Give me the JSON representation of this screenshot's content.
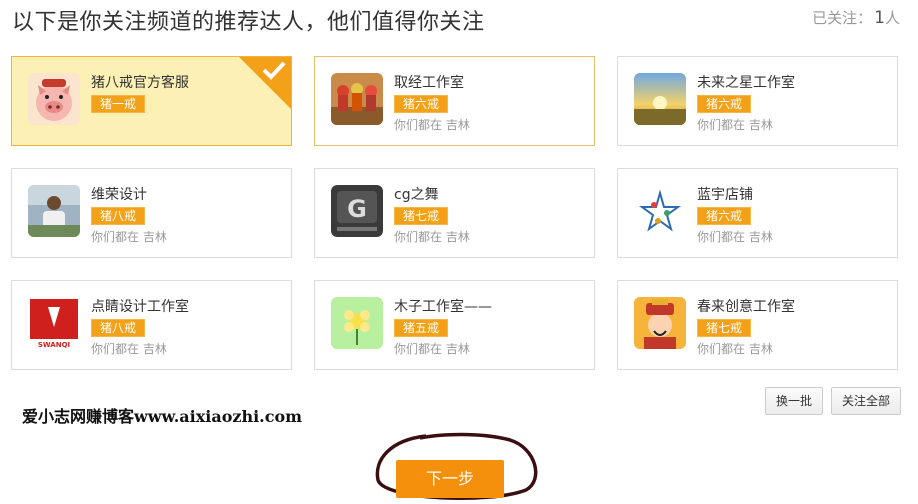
{
  "header": {
    "title": "以下是你关注频道的推荐达人，他们值得你关注",
    "followed_label": "已关注：",
    "followed_count": "1",
    "followed_unit": "人"
  },
  "cards": [
    {
      "name": "猪八戒官方客服",
      "badge": "猪一戒",
      "location": "",
      "selected": true,
      "avatar_icon": "pig-mascot-avatar-icon"
    },
    {
      "name": "取经工作室",
      "badge": "猪六戒",
      "location": "你们都在 吉林",
      "selected": false,
      "avatar_icon": "monk-group-avatar-icon"
    },
    {
      "name": "未来之星工作室",
      "badge": "猪六戒",
      "location": "你们都在 吉林",
      "selected": false,
      "avatar_icon": "sunset-avatar-icon"
    },
    {
      "name": "维荣设计",
      "badge": "猪八戒",
      "location": "你们都在 吉林",
      "selected": false,
      "avatar_icon": "person-photo-avatar-icon"
    },
    {
      "name": "cg之舞",
      "badge": "猪七戒",
      "location": "你们都在 吉林",
      "selected": false,
      "avatar_icon": "cg-logo-avatar-icon"
    },
    {
      "name": "蓝宇店铺",
      "badge": "猪六戒",
      "location": "你们都在 吉林",
      "selected": false,
      "avatar_icon": "star-logo-avatar-icon"
    },
    {
      "name": "点睛设计工作室",
      "badge": "猪八戒",
      "location": "你们都在 吉林",
      "selected": false,
      "avatar_icon": "swanqi-logo-avatar-icon",
      "avatar_text": "SWANQI"
    },
    {
      "name": "木子工作室——",
      "badge": "猪五戒",
      "location": "你们都在 吉林",
      "selected": false,
      "avatar_icon": "flower-avatar-icon"
    },
    {
      "name": "春来创意工作室",
      "badge": "猪七戒",
      "location": "你们都在 吉林",
      "selected": false,
      "avatar_icon": "god-of-wealth-avatar-icon"
    }
  ],
  "actions": {
    "refresh_label": "换一批",
    "follow_all_label": "关注全部",
    "next_label": "下一步"
  },
  "watermark": "爱小志网赚博客www.aixiaozhi.com",
  "colors": {
    "accent": "#f4a11a",
    "selected_bg": "#fdf0b4",
    "next_button": "#f4900c"
  }
}
